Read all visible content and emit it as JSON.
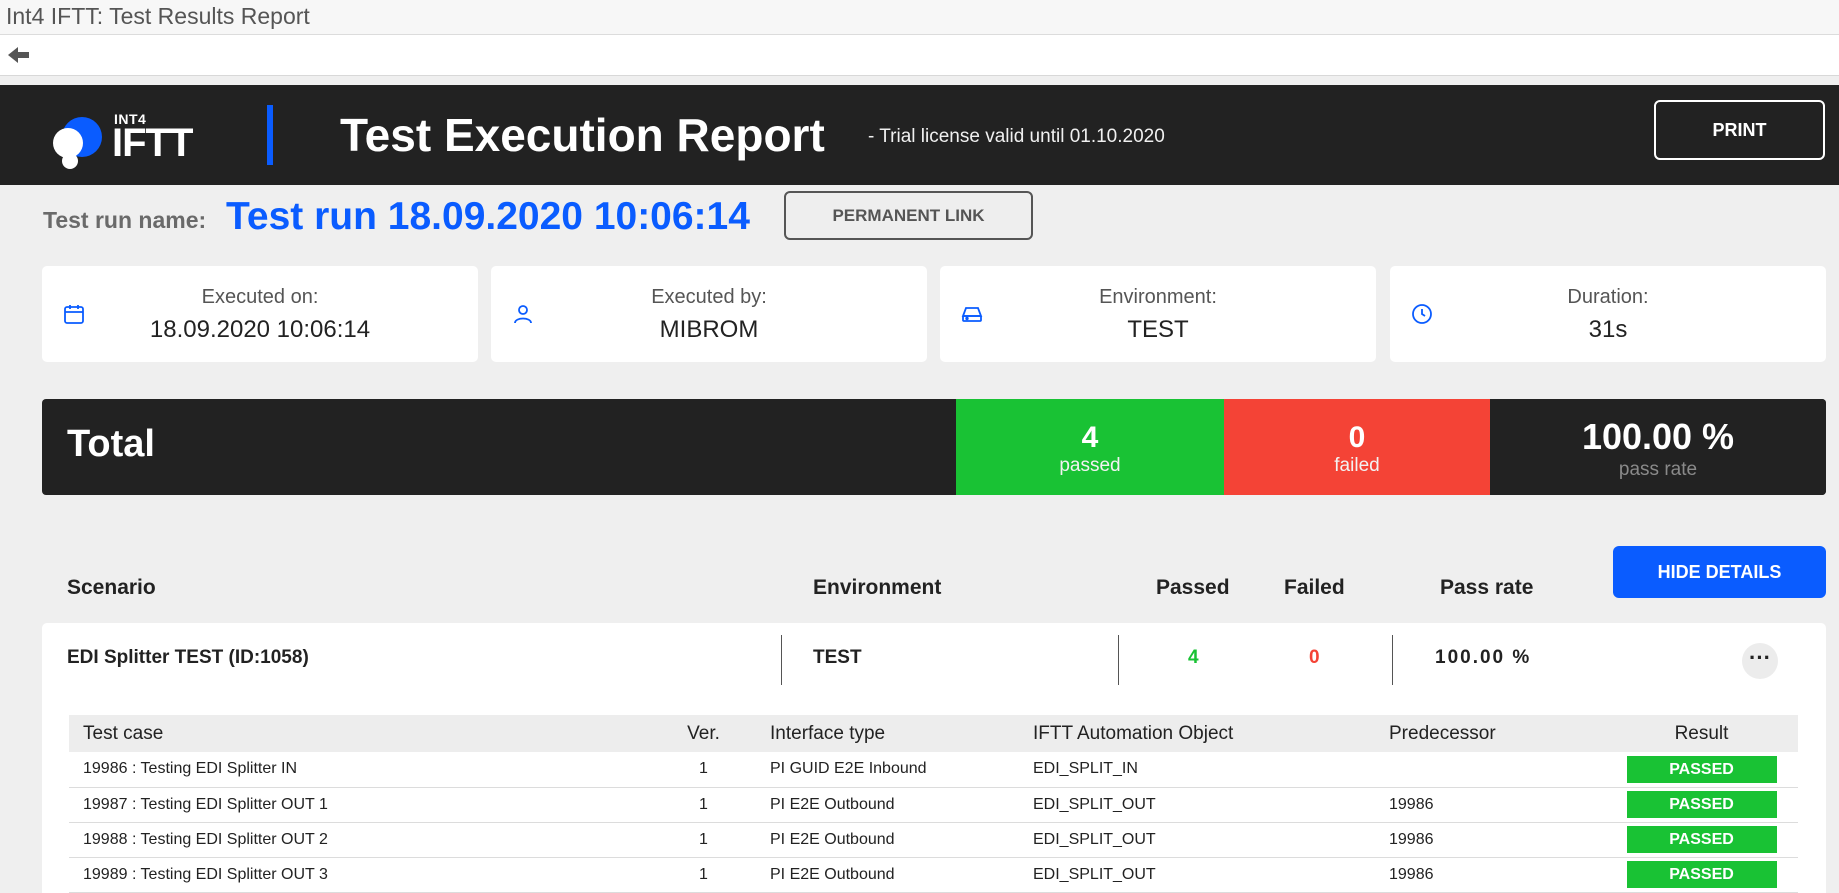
{
  "window": {
    "title": "Int4 IFTT: Test Results Report"
  },
  "header": {
    "logo_small": "INT4",
    "logo_main": "IFTT",
    "title": "Test Execution Report",
    "license": "- Trial license valid until 01.10.2020",
    "print_label": "PRINT"
  },
  "run": {
    "label": "Test run name:",
    "name": "Test run 18.09.2020 10:06:14",
    "permanent_link": "PERMANENT LINK"
  },
  "cards": [
    {
      "label": "Executed on:",
      "value": "18.09.2020 10:06:14",
      "icon": "calendar-icon"
    },
    {
      "label": "Executed by:",
      "value": "MIBROM",
      "icon": "user-icon"
    },
    {
      "label": "Environment:",
      "value": "TEST",
      "icon": "drive-icon"
    },
    {
      "label": "Duration:",
      "value": "31s",
      "icon": "clock-icon"
    }
  ],
  "total": {
    "label": "Total",
    "passed": "4",
    "passed_label": "passed",
    "failed": "0",
    "failed_label": "failed",
    "pass_rate": "100.00 %",
    "pass_rate_label": "pass rate"
  },
  "scenario_table": {
    "hide_details_label": "HIDE DETAILS",
    "headers": {
      "scenario": "Scenario",
      "environment": "Environment",
      "passed": "Passed",
      "failed": "Failed",
      "pass_rate": "Pass rate"
    },
    "scenarios": [
      {
        "name": "EDI Splitter TEST (ID:1058)",
        "environment": "TEST",
        "passed": "4",
        "failed": "0",
        "pass_rate": "100.00 %",
        "more": "···",
        "test_headers": [
          "Test case",
          "Ver.",
          "Interface type",
          "IFTT Automation Object",
          "Predecessor",
          "Result"
        ],
        "test_cases": [
          {
            "name": "19986 : Testing EDI Splitter IN",
            "ver": "1",
            "interface": "PI GUID E2E Inbound",
            "object": "EDI_SPLIT_IN",
            "predecessor": "",
            "result": "PASSED"
          },
          {
            "name": "19987 : Testing EDI Splitter OUT 1",
            "ver": "1",
            "interface": "PI E2E Outbound",
            "object": "EDI_SPLIT_OUT",
            "predecessor": "19986",
            "result": "PASSED"
          },
          {
            "name": "19988 : Testing EDI Splitter OUT 2",
            "ver": "1",
            "interface": "PI E2E Outbound",
            "object": "EDI_SPLIT_OUT",
            "predecessor": "19986",
            "result": "PASSED"
          },
          {
            "name": "19989 : Testing EDI Splitter OUT 3",
            "ver": "1",
            "interface": "PI E2E Outbound",
            "object": "EDI_SPLIT_OUT",
            "predecessor": "19986",
            "result": "PASSED"
          }
        ]
      }
    ]
  },
  "colors": {
    "accent": "#0a5cff",
    "dark": "#222222",
    "passed": "#19c234",
    "failed": "#f44336"
  }
}
